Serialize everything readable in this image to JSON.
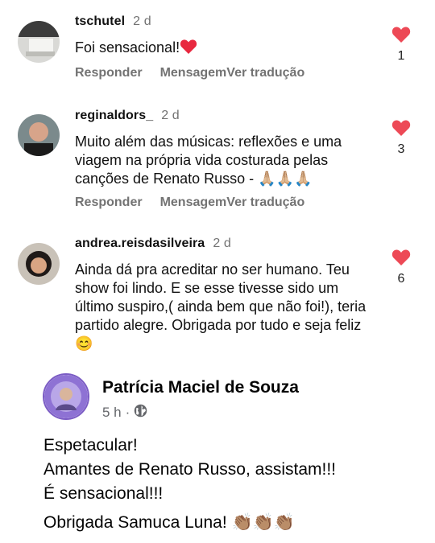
{
  "comments": [
    {
      "username": "tschutel",
      "time": "2 d",
      "text": "Foi sensacional!",
      "reply": "Responder",
      "message": "Mensagem",
      "translate": "Ver tradução",
      "likes": "1"
    },
    {
      "username": "reginaldors_",
      "time": "2 d",
      "text": "Muito além das músicas: reflexões e uma viagem na própria vida costurada pelas canções de Renato Russo - 🙏🏼🙏🏼🙏🏼",
      "reply": "Responder",
      "message": "Mensagem",
      "translate": "Ver tradução",
      "likes": "3"
    },
    {
      "username": "andrea.reisdasilveira",
      "time": "2 d",
      "text": "Ainda dá pra acreditar no ser humano. Teu show foi lindo. E se esse tivesse sido um último suspiro,( ainda bem que não foi!), teria partido alegre. Obrigada por tudo e seja feliz 😊",
      "likes": "6"
    }
  ],
  "facebook_post": {
    "author": "Patrícia Maciel de Souza",
    "time": "5 h",
    "lines": [
      "Espetacular!",
      "Amantes de Renato Russo, assistam!!!",
      "É sensacional!!!",
      "Obrigada Samuca Luna! 👏🏽👏🏽👏🏽"
    ]
  },
  "colors": {
    "heart": "#ed4956",
    "muted": "#737373",
    "fb_meta": "#65676b"
  },
  "icons": [
    "heart-icon",
    "globe-icon"
  ]
}
